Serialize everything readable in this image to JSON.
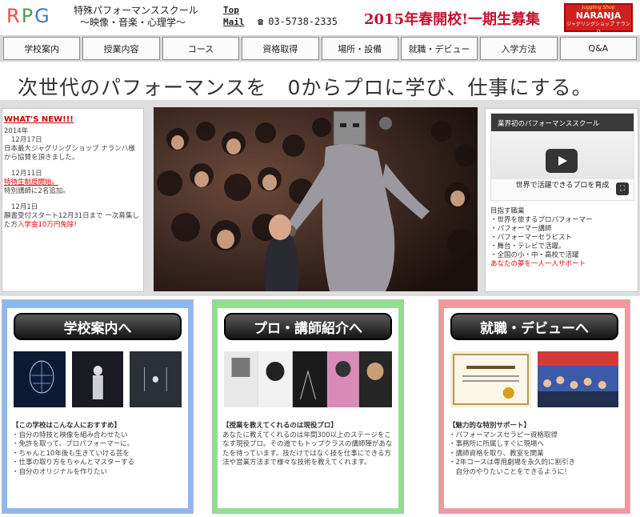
{
  "header": {
    "logo": {
      "r": "R",
      "p": "P",
      "g": "G"
    },
    "school_name": "特殊パフォーマンススクール",
    "school_sub": "〜映像・音楽・心理学〜",
    "links": [
      "Top",
      "Mail"
    ],
    "phone_icon": "telephone-icon",
    "phone": "03-5738-2335",
    "recruit": "2015年春開校!一期生募集",
    "shop": {
      "l1": "Juggling Shop",
      "l2": "NARANJA",
      "l3": "ジャグリングショップ ナランハ"
    }
  },
  "nav": [
    "学校案内",
    "授業内容",
    "コース",
    "資格取得",
    "場所・設備",
    "就職・デビュー",
    "入学方法",
    "Q&A"
  ],
  "tagline": "次世代のパフォーマンスを　0からプロに学び、仕事にする。",
  "news": {
    "title": "WHAT'S NEW!!!",
    "year": "2014年",
    "items": [
      {
        "date": "12月17日",
        "text": "日本最大ジャグリングショップ ナランハ様から協賛を頂きました。"
      },
      {
        "date": "12月11日",
        "link": "特待生制度開始。",
        "text": "特別講師に2名追加。"
      },
      {
        "date": "12月1日",
        "text": "願書受付スタート12月31日まで 一次募集した方",
        "red": "入学金10万円免除!"
      }
    ]
  },
  "video": {
    "top": "業界初のパフォーマンススクール",
    "bottom": "世界で活躍できるプロを育成",
    "fullscreen_icon": "fullscreen-icon"
  },
  "side_list": {
    "head": "目指す職業",
    "items": [
      "・世界を旅するプロパフォーマー",
      "・パフォーマー講師",
      "・パフォーマーセラピスト",
      "・舞台・テレビで活躍。",
      "・全国の小・中・高校で活躍"
    ],
    "red": "あなたの夢を一人一人サポート"
  },
  "cards": [
    {
      "button": "学校案内へ",
      "head": "【この学校はこんな人におすすめ】",
      "lines": [
        "・自分の特技と映像を組み合わせたい",
        "・免許を取って、プロパフォーマーに。",
        "・ちゃんと10年後も生きていける芸を",
        "・仕事の取り方をちゃんとマスターする",
        "・自分のオリジナルを作りたい"
      ]
    },
    {
      "button": "プロ・講師紹介へ",
      "head": "【授業を教えてくれるのは現役プロ】",
      "lines": [
        "あなたに教えてくれるのは年間300以上のステージをこなす現役プロ。その道でもトップクラスの講師陣があなたを待っています。技だけではなく技を仕事にできる方法や営業方法まで様々な技術を教えてくれます。"
      ]
    },
    {
      "button": "就職・デビューへ",
      "head": "【魅力的な特別サポート】",
      "lines": [
        "・パフォーマンスセラピー資格取得",
        "・事務所に所属しすぐに現場へ",
        "・講師資格を取り、教室を開業",
        "・2年コースは専用劇場を永久的に割引き",
        "　自分のやりたいことをできるように!"
      ]
    }
  ]
}
